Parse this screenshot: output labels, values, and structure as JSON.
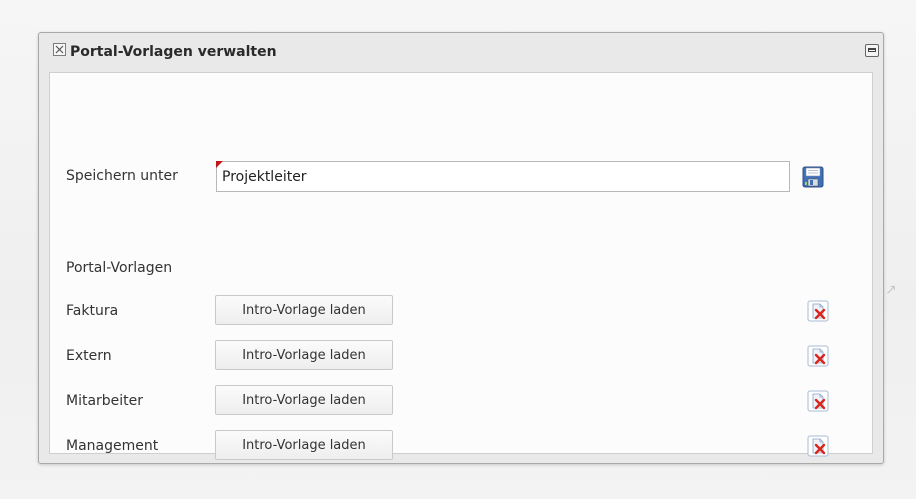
{
  "dialog": {
    "title": "Portal-Vorlagen verwalten",
    "close_icon": "close-icon",
    "minimize_icon": "minimize-icon"
  },
  "save": {
    "label": "Speichern unter",
    "value": "Projektleiter",
    "icon": "floppy-disk-icon"
  },
  "templates": {
    "heading": "Portal-Vorlagen",
    "delete_icon": "delete-document-icon",
    "items": [
      {
        "name": "Faktura",
        "button_label": "Intro-Vorlage laden"
      },
      {
        "name": "Extern",
        "button_label": "Intro-Vorlage laden"
      },
      {
        "name": "Mitarbeiter",
        "button_label": "Intro-Vorlage laden"
      },
      {
        "name": "Management",
        "button_label": "Intro-Vorlage laden"
      }
    ]
  },
  "colors": {
    "dirty_marker": "#c0181b",
    "dialog_bg": "#e9e9e9",
    "content_bg": "#fcfcfc",
    "delete_icon_accent": "#d9251d",
    "save_icon_accent": "#3f6fb5"
  }
}
